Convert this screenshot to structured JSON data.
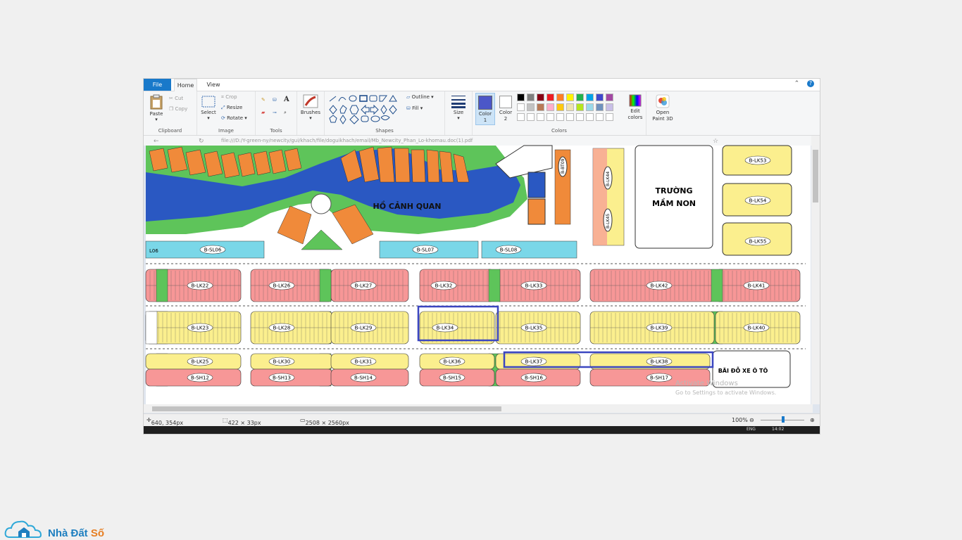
{
  "tabs": {
    "file": "File",
    "home": "Home",
    "view": "View"
  },
  "clipboard": {
    "paste": "Paste",
    "cut": "Cut",
    "copy": "Copy",
    "label": "Clipboard"
  },
  "image": {
    "select": "Select",
    "crop": "Crop",
    "resize": "Resize",
    "rotate": "Rotate",
    "label": "Image"
  },
  "tools": {
    "label": "Tools"
  },
  "brushes": {
    "label": "Brushes"
  },
  "shapes": {
    "outline": "Outline",
    "fill": "Fill",
    "label": "Shapes"
  },
  "size": {
    "label": "Size"
  },
  "colors": {
    "color1": "Color 1",
    "color2": "Color 2",
    "edit": "Edit colors",
    "label": "Colors",
    "palette_row1": [
      "#000000",
      "#7f7f7f",
      "#880015",
      "#ed1c24",
      "#ff7f27",
      "#fff200",
      "#22b14c",
      "#00a2e8",
      "#3f48cc",
      "#a349a4"
    ],
    "palette_row2": [
      "#ffffff",
      "#c3c3c3",
      "#b97a57",
      "#ffaec9",
      "#ffc90e",
      "#efe4b0",
      "#b5e61d",
      "#99d9ea",
      "#7092be",
      "#c8bfe7"
    ],
    "accent": "#4b57c8"
  },
  "paint3d": {
    "label": "Open Paint 3D"
  },
  "browser": {
    "url": "file:///D:/Y-green-ny/newcity/gui/khach/file/doguikhach/email/Mb_Newcity_Phan_Lo-khomau.doc(1).pdf"
  },
  "map": {
    "lake": "HỒ CẢNH QUAN",
    "school_line1": "TRƯỜNG",
    "school_line2": "MẦM NON",
    "parking": "BÃI ĐỖ XE Ô TÔ",
    "row1": [
      "B-LK22",
      "B-LK26",
      "B-LK27",
      "B-LK32",
      "B-LK33",
      "B-LK42",
      "B-LK41"
    ],
    "row2": [
      "B-LK23",
      "B-LK28",
      "B-LK29",
      "B-LK34",
      "B-LK35",
      "B-LK39",
      "B-LK40"
    ],
    "row3a": [
      "B-LK25",
      "B-LK30",
      "B-LK31",
      "B-LK36",
      "B-LK37",
      "B-LK38"
    ],
    "row3b": [
      "B-SH12",
      "B-SH13",
      "B-SH14",
      "B-SH15",
      "B-SH16",
      "B-SH17"
    ],
    "sl": [
      "B-SL06",
      "B-SL07",
      "B-SL08"
    ],
    "right": [
      "B-LK53",
      "B-LK54",
      "B-LK55"
    ],
    "vertical": [
      "B-BT09",
      "B-LK44",
      "B-LK45"
    ],
    "edge": "L06",
    "watermark1": "Activate Windows",
    "watermark2": "Go to Settings to activate Windows."
  },
  "status": {
    "cursor": "640, 354px",
    "selection": "422 × 33px",
    "canvas": "2508 × 2560px",
    "zoom": "100%"
  },
  "taskbar": {
    "lang": "ENG",
    "time": "14:02"
  },
  "brand": {
    "name_a": "Nhà Đất",
    "name_b": "Số"
  }
}
